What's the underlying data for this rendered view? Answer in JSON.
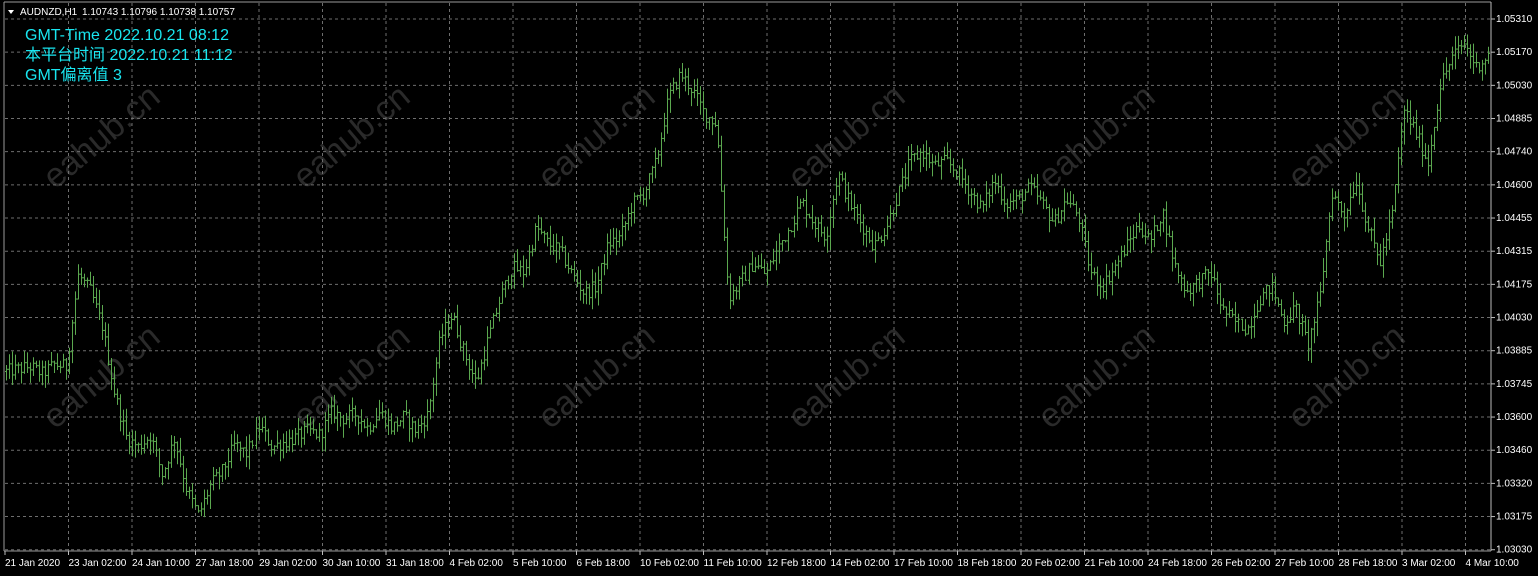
{
  "header": {
    "symbol_label": "AUDNZD,H1",
    "ohlc": "1.10743 1.10796 1.10738 1.10757"
  },
  "info": {
    "gmt_time": "GMT-Time 2022.10.21 08:12",
    "platform_time": "本平台时间 2022.10.21 11:12",
    "gmt_offset": "GMT偏离值 3"
  },
  "watermark": "eahub.cn",
  "colors": {
    "background": "#000000",
    "grid": "#6e6e6e",
    "bars": "#5ba84f",
    "info_text": "#19e6f0",
    "axis_text": "#ffffff",
    "watermark": "#2a2a2a"
  },
  "chart_data": {
    "type": "line",
    "style": "ohlc-bars",
    "timeframe": "H1",
    "grid": true,
    "y_ticks": [
      "1.05310",
      "1.05170",
      "1.05030",
      "1.04885",
      "1.04740",
      "1.04600",
      "1.04455",
      "1.04315",
      "1.04175",
      "1.04030",
      "1.03885",
      "1.03745",
      "1.03600",
      "1.03460",
      "1.03320",
      "1.03175",
      "1.03030"
    ],
    "ylim": [
      1.0303,
      1.0535
    ],
    "x_ticks": [
      "21 Jan 2020",
      "23 Jan 02:00",
      "24 Jan 10:00",
      "27 Jan 18:00",
      "29 Jan 02:00",
      "30 Jan 10:00",
      "31 Jan 18:00",
      "4 Feb 02:00",
      "5 Feb 10:00",
      "6 Feb 18:00",
      "10 Feb 02:00",
      "11 Feb 10:00",
      "12 Feb 18:00",
      "14 Feb 02:00",
      "17 Feb 10:00",
      "18 Feb 18:00",
      "20 Feb 02:00",
      "21 Feb 10:00",
      "24 Feb 18:00",
      "26 Feb 02:00",
      "27 Feb 10:00",
      "28 Feb 18:00",
      "3 Mar 02:00",
      "4 Mar 10:00"
    ],
    "close_path": [
      [
        0,
        1.0379
      ],
      [
        2,
        1.0381
      ],
      [
        3,
        1.0378
      ],
      [
        4,
        1.0382
      ],
      [
        5,
        1.0381
      ],
      [
        6,
        1.042
      ],
      [
        7,
        1.0413
      ],
      [
        8,
        1.0398
      ],
      [
        9,
        1.037
      ],
      [
        10,
        1.0351
      ],
      [
        11,
        1.0347
      ],
      [
        12,
        1.0352
      ],
      [
        13,
        1.0335
      ],
      [
        14,
        1.0351
      ],
      [
        15,
        1.0329
      ],
      [
        16,
        1.0318
      ],
      [
        17,
        1.0331
      ],
      [
        18,
        1.0337
      ],
      [
        19,
        1.0348
      ],
      [
        20,
        1.0344
      ],
      [
        21,
        1.0356
      ],
      [
        22,
        1.0347
      ],
      [
        23,
        1.0349
      ],
      [
        24,
        1.0351
      ],
      [
        25,
        1.0354
      ],
      [
        26,
        1.0352
      ],
      [
        27,
        1.0362
      ],
      [
        28,
        1.0359
      ],
      [
        29,
        1.0361
      ],
      [
        30,
        1.0355
      ],
      [
        31,
        1.0362
      ],
      [
        32,
        1.0355
      ],
      [
        33,
        1.036
      ],
      [
        34,
        1.0354
      ],
      [
        35,
        1.0361
      ],
      [
        36,
        1.0393
      ],
      [
        37,
        1.0403
      ],
      [
        38,
        1.0387
      ],
      [
        39,
        1.0374
      ],
      [
        40,
        1.0393
      ],
      [
        41,
        1.041
      ],
      [
        42,
        1.0423
      ],
      [
        43,
        1.0421
      ],
      [
        44,
        1.044
      ],
      [
        45,
        1.0433
      ],
      [
        46,
        1.043
      ],
      [
        47,
        1.042
      ],
      [
        48,
        1.0412
      ],
      [
        49,
        1.0415
      ],
      [
        50,
        1.0433
      ],
      [
        51,
        1.0436
      ],
      [
        52,
        1.045
      ],
      [
        53,
        1.0455
      ],
      [
        54,
        1.0468
      ],
      [
        55,
        1.0495
      ],
      [
        56,
        1.0505
      ],
      [
        57,
        1.0498
      ],
      [
        58,
        1.0488
      ],
      [
        59,
        1.0484
      ],
      [
        60,
        1.041
      ],
      [
        61,
        1.0417
      ],
      [
        62,
        1.0425
      ],
      [
        63,
        1.042
      ],
      [
        64,
        1.0431
      ],
      [
        65,
        1.044
      ],
      [
        66,
        1.0451
      ],
      [
        67,
        1.0442
      ],
      [
        68,
        1.0436
      ],
      [
        69,
        1.0463
      ],
      [
        70,
        1.045
      ],
      [
        71,
        1.0441
      ],
      [
        72,
        1.0432
      ],
      [
        73,
        1.044
      ],
      [
        74,
        1.0454
      ],
      [
        75,
        1.0468
      ],
      [
        76,
        1.0472
      ],
      [
        77,
        1.0466
      ],
      [
        78,
        1.0468
      ],
      [
        79,
        1.0463
      ],
      [
        80,
        1.0455
      ],
      [
        81,
        1.0448
      ],
      [
        82,
        1.046
      ],
      [
        83,
        1.045
      ],
      [
        84,
        1.0452
      ],
      [
        85,
        1.0457
      ],
      [
        86,
        1.045
      ],
      [
        87,
        1.0442
      ],
      [
        88,
        1.0452
      ],
      [
        89,
        1.0445
      ],
      [
        90,
        1.0421
      ],
      [
        91,
        1.0415
      ],
      [
        92,
        1.0423
      ],
      [
        93,
        1.0432
      ],
      [
        94,
        1.0441
      ],
      [
        95,
        1.0434
      ],
      [
        96,
        1.0447
      ],
      [
        97,
        1.0424
      ],
      [
        98,
        1.0413
      ],
      [
        99,
        1.0417
      ],
      [
        100,
        1.0421
      ],
      [
        101,
        1.0405
      ],
      [
        102,
        1.04
      ],
      [
        103,
        1.0397
      ],
      [
        104,
        1.041
      ],
      [
        105,
        1.0415
      ],
      [
        106,
        1.04
      ],
      [
        107,
        1.0406
      ],
      [
        108,
        1.039
      ],
      [
        109,
        1.041
      ],
      [
        110,
        1.0455
      ],
      [
        111,
        1.0445
      ],
      [
        112,
        1.046
      ],
      [
        113,
        1.044
      ],
      [
        114,
        1.0425
      ],
      [
        115,
        1.0445
      ],
      [
        116,
        1.049
      ],
      [
        117,
        1.048
      ],
      [
        118,
        1.0467
      ],
      [
        119,
        1.05
      ],
      [
        120,
        1.0512
      ],
      [
        121,
        1.0518
      ],
      [
        122,
        1.0508
      ],
      [
        123,
        1.0513
      ]
    ]
  }
}
